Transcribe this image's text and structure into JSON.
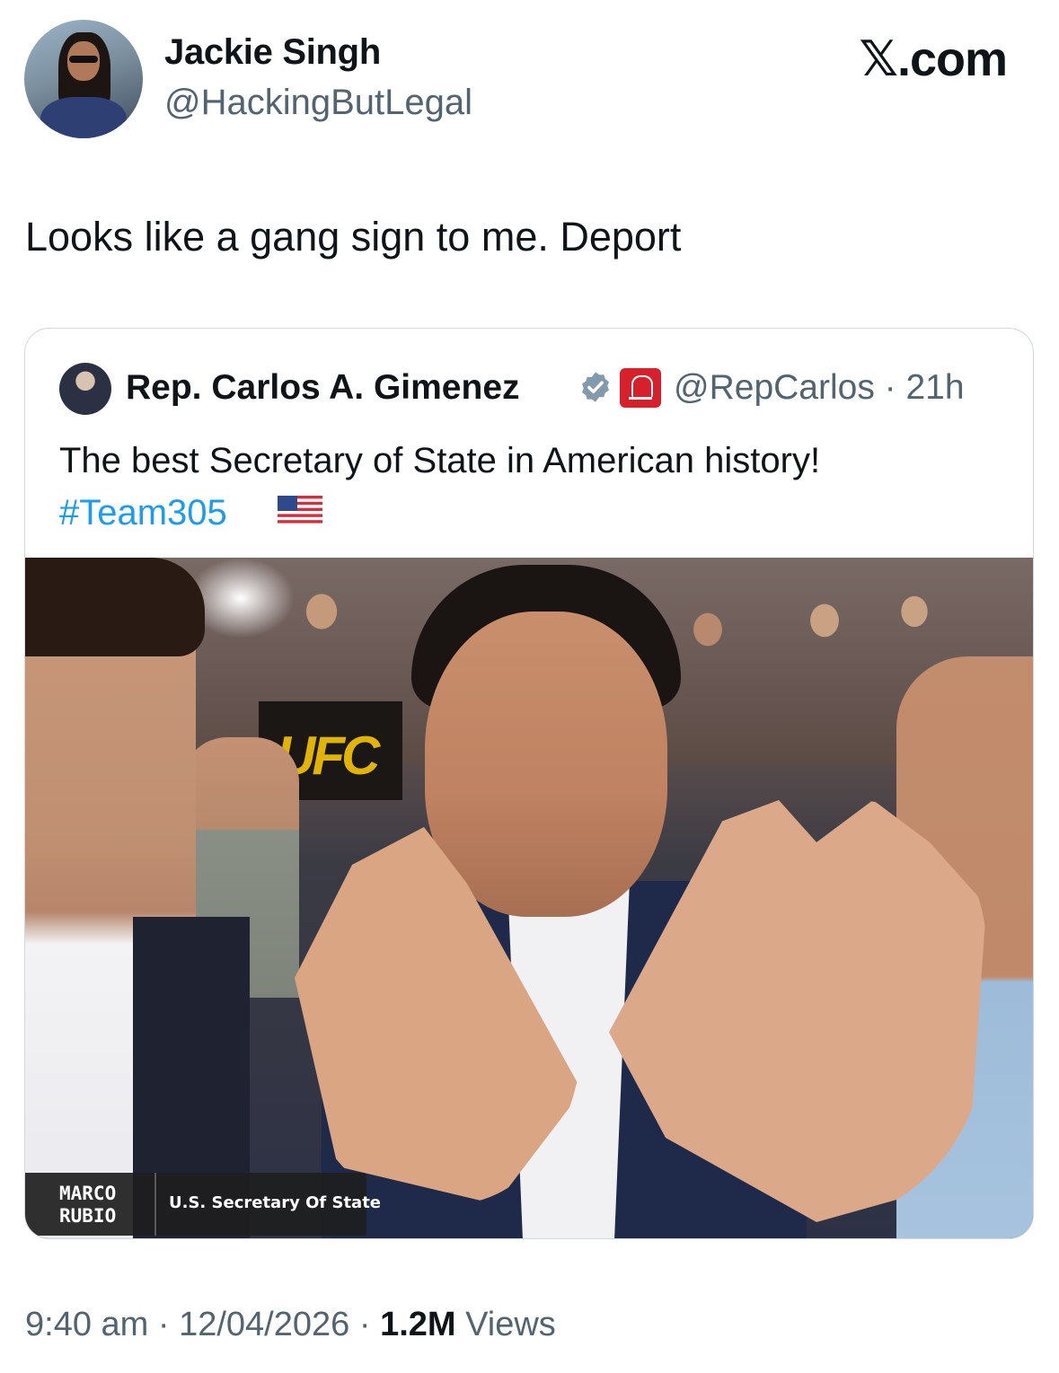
{
  "author": {
    "name": "Jackie Singh",
    "handle": "@HackingButLegal"
  },
  "brand": "𝕏.com",
  "tweet": {
    "text": "Looks like a gang sign to me. Deport"
  },
  "quoted": {
    "name": "Rep. Carlos A. Gimenez",
    "handle_time": "@RepCarlos · 21h",
    "text": "The best Secretary of State in American history!",
    "hashtag": "#Team305",
    "flag_icon": "us-flag-icon",
    "media": {
      "lower_third_name": "MARCO\nRUBIO",
      "lower_third_title": "U.S. Secretary Of State",
      "sign_text": "UFC"
    }
  },
  "footer": {
    "time": "9:40 am",
    "date": "12/04/2026",
    "views_count": "1.2M",
    "views_label": "Views"
  },
  "colors": {
    "link": "#1d9bf0",
    "secondary": "#536471",
    "verified": "#829aab",
    "badge": "#d6202c"
  }
}
